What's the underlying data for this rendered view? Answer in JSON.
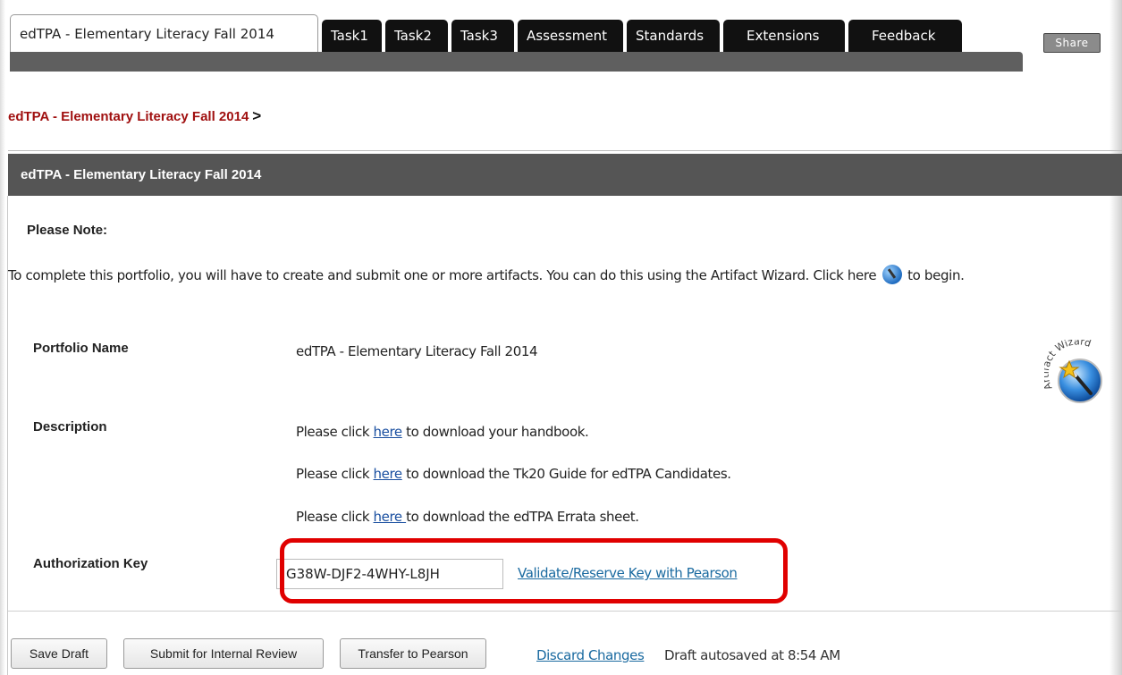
{
  "tabs": {
    "active_label": "edTPA - Elementary Literacy Fall 2014",
    "items": [
      {
        "label": "Task1"
      },
      {
        "label": "Task2"
      },
      {
        "label": "Task3"
      },
      {
        "label": "Assessment"
      },
      {
        "label": "Standards"
      },
      {
        "label": "Extensions"
      },
      {
        "label": "Feedback"
      }
    ],
    "share_label": "Share"
  },
  "breadcrumb": {
    "link": "edTPA - Elementary Literacy Fall 2014",
    "separator": ">"
  },
  "section": {
    "title": "edTPA - Elementary Literacy Fall 2014"
  },
  "note": {
    "title": "Please Note:",
    "text_before": "To complete this portfolio, you will have to create and submit one or more artifacts. You can do this using the Artifact Wizard. Click here",
    "text_after": "to begin."
  },
  "fields": {
    "portfolio_name_label": "Portfolio Name",
    "portfolio_name_value": "edTPA - Elementary Literacy Fall 2014",
    "description_label": "Description",
    "desc_lines": [
      {
        "prefix": "Please click ",
        "link": "here",
        "suffix": " to download your handbook."
      },
      {
        "prefix": "Please click ",
        "link": "here",
        "suffix": " to download the Tk20 Guide for edTPA Candidates."
      },
      {
        "prefix": "Please click ",
        "link": "here ",
        "suffix": "to download the edTPA Errata sheet."
      }
    ],
    "auth_key_label": "Authorization Key",
    "auth_key_value": "G38W-DJF2-4WHY-L8JH",
    "validate_link": "Validate/Reserve Key with Pearson"
  },
  "wizard_badge": {
    "text": "Artifact Wizard",
    "icon": "magic-wand-icon"
  },
  "footer": {
    "save_draft": "Save Draft",
    "submit_review": "Submit for Internal Review",
    "transfer": "Transfer to Pearson",
    "discard": "Discard Changes",
    "autosave": "Draft autosaved at 8:54 AM"
  },
  "colors": {
    "tab_bg": "#111111",
    "section_bg": "#555555",
    "breadcrumb": "#a01010",
    "link": "#1a6aa0",
    "highlight": "#e00000"
  }
}
